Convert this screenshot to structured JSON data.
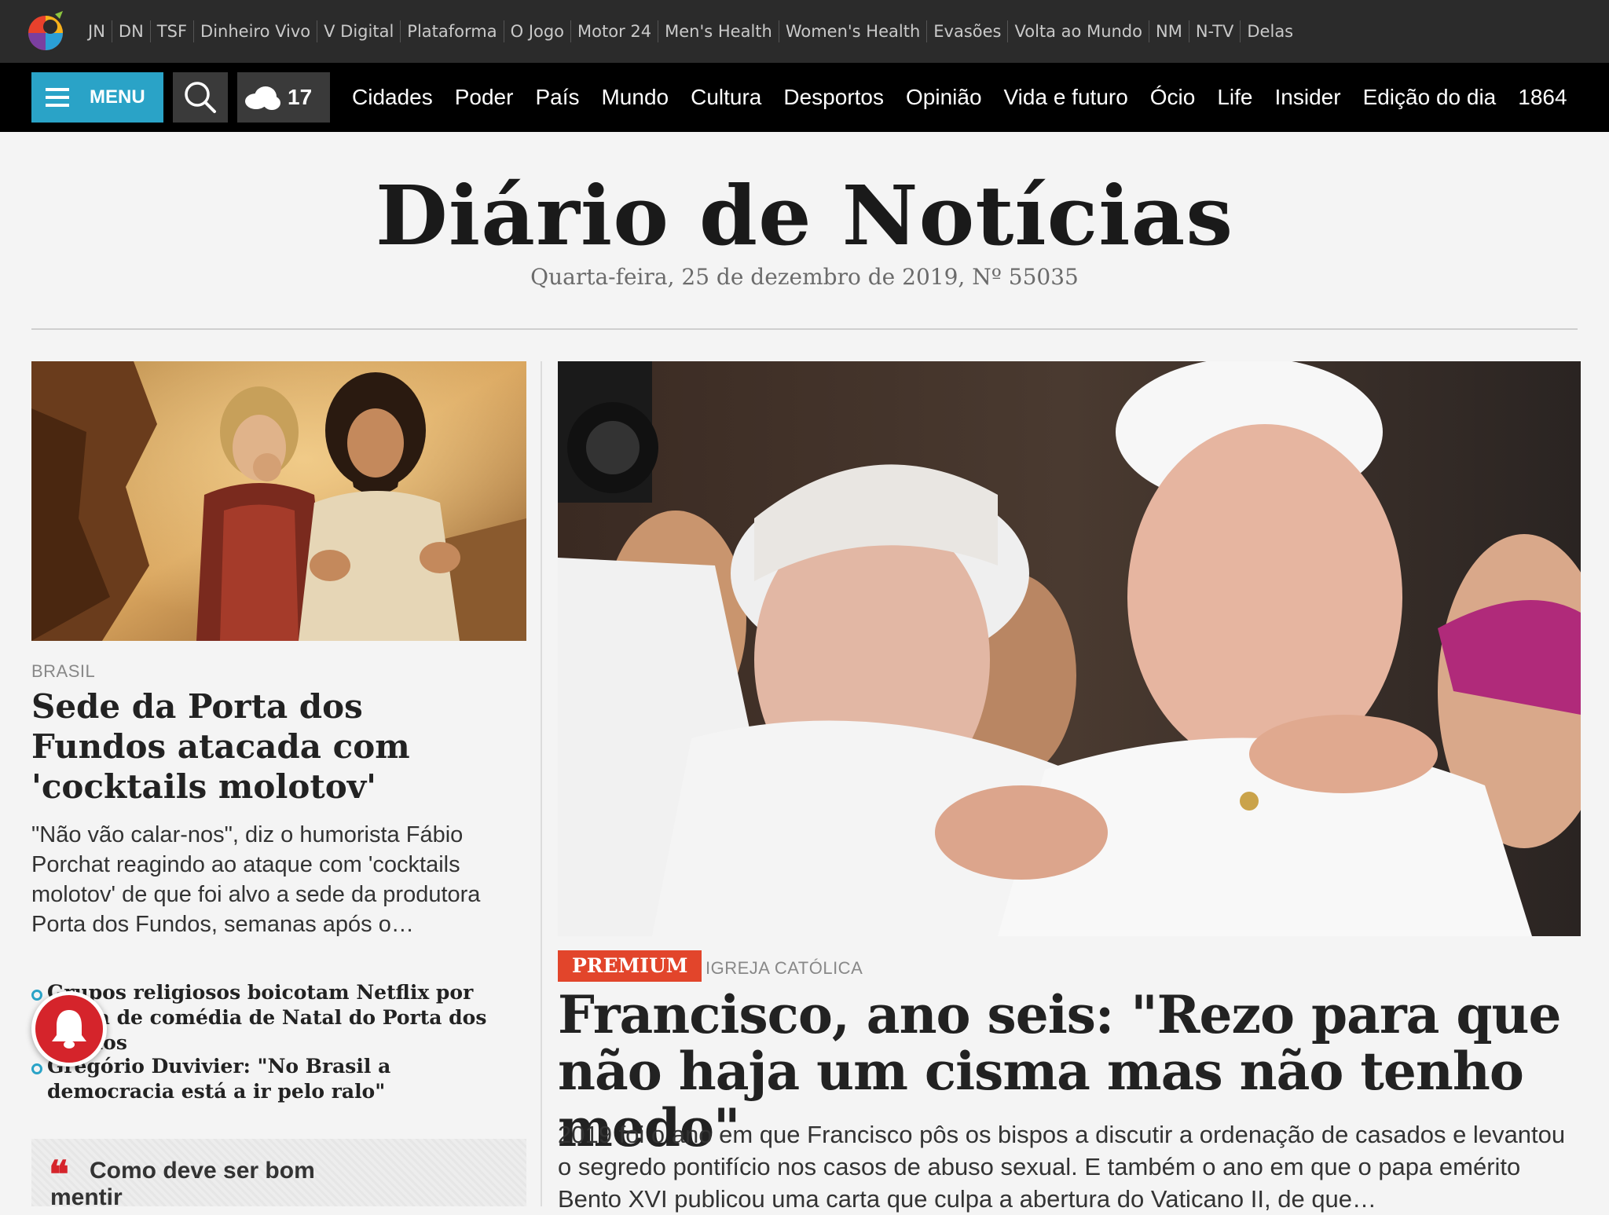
{
  "network": {
    "links": [
      "JN",
      "DN",
      "TSF",
      "Dinheiro Vivo",
      "V Digital",
      "Plataforma",
      "O Jogo",
      "Motor 24",
      "Men's Health",
      "Women's Health",
      "Evasões",
      "Volta ao Mundo",
      "NM",
      "N-TV",
      "Delas"
    ],
    "bar_color": "#2b2b2b"
  },
  "nav": {
    "menu_label": "MENU",
    "temperature": "17",
    "items": [
      "Cidades",
      "Poder",
      "País",
      "Mundo",
      "Cultura",
      "Desportos",
      "Opinião",
      "Vida e futuro",
      "Ócio",
      "Life",
      "Insider",
      "Edição do dia",
      "1864"
    ],
    "accent": "#2aa3c7"
  },
  "masthead": {
    "title": "Diário de Notícias",
    "date": "Quarta-feira, 25 de dezembro de 2019, Nº 55035"
  },
  "left_story": {
    "category": "BRASIL",
    "headline": "Sede da Porta dos Fundos atacada com 'cocktails molotov'",
    "lead": "\"Não vão calar-nos\", diz o humorista Fábio Porchat reagindo ao ataque com 'cocktails molotov' de que foi alvo a sede da produtora Porta dos Fundos, semanas após o…",
    "related": [
      "Grupos religiosos boicotam Netflix por causa de comédia de Natal do Porta dos Fundos",
      "Gregório Duvivier: \"No Brasil a democracia está a ir pelo ralo\""
    ]
  },
  "opinion": {
    "quote_text": "Como deve ser bom mentir"
  },
  "main_story": {
    "badge": "PREMIUM",
    "category": "IGREJA CATÓLICA",
    "headline": "Francisco, ano seis: \"Rezo para que não haja um cisma mas não tenho medo\"",
    "lead": "2019 foi o ano em que Francisco pôs os bispos a discutir a ordenação de casados e levantou o segredo pontifício nos casos de abuso sexual. E também o ano em que o papa emérito Bento XVI publicou uma carta que culpa a abertura do Vaticano II, de que…",
    "badge_color": "#e2452b"
  },
  "notification": {
    "icon": "bell-icon",
    "color": "#d5242b"
  }
}
